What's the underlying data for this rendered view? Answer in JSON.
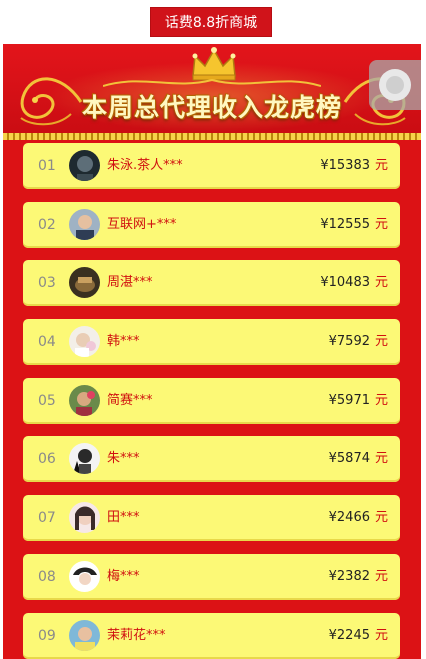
{
  "mall_button": "话费8.8折商城",
  "banner": {
    "title": "本周总代理收入龙虎榜"
  },
  "colors": {
    "board": "#dc1215",
    "row": "#fcf976",
    "name": "#d01010",
    "gold": "#f6d34a"
  },
  "rankings": [
    {
      "rank": "01",
      "name": "朱泳.茶人***",
      "amount": "¥15383",
      "unit": "元"
    },
    {
      "rank": "02",
      "name": "互联网+***",
      "amount": "¥12555",
      "unit": "元"
    },
    {
      "rank": "03",
      "name": "周湛***",
      "amount": "¥10483",
      "unit": "元"
    },
    {
      "rank": "04",
      "name": "韩***",
      "amount": "¥7592",
      "unit": "元"
    },
    {
      "rank": "05",
      "name": "简赛***",
      "amount": "¥5971",
      "unit": "元"
    },
    {
      "rank": "06",
      "name": "朱***",
      "amount": "¥5874",
      "unit": "元"
    },
    {
      "rank": "07",
      "name": "田***",
      "amount": "¥2466",
      "unit": "元"
    },
    {
      "rank": "08",
      "name": "梅***",
      "amount": "¥2382",
      "unit": "元"
    },
    {
      "rank": "09",
      "name": "茉莉花***",
      "amount": "¥2245",
      "unit": "元"
    }
  ]
}
